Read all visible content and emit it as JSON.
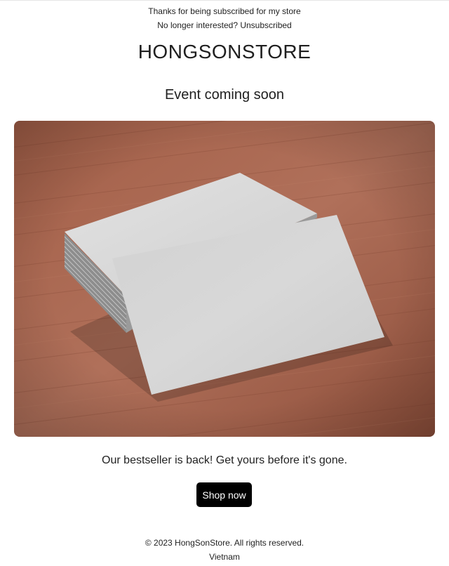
{
  "preheader": {
    "thanks_text": "Thanks for being subscribed for my store",
    "unsubscribe_prefix": "No longer interested? ",
    "unsubscribe_link": "Unsubscribed"
  },
  "brand": {
    "name": "HONGSONSTORE"
  },
  "hero": {
    "headline": "Event coming soon",
    "image": {
      "subject": "stack of blank business cards on wooden table",
      "icon": "business-cards-image"
    }
  },
  "promo": {
    "tagline": "Our bestseller is back! Get yours before it's gone.",
    "cta_label": "Shop now"
  },
  "footer": {
    "copyright": "© 2023 HongSonStore. All rights reserved.",
    "country": "Vietnam"
  },
  "colors": {
    "cta_background": "#000000",
    "cta_text": "#ffffff",
    "wood": "#a8664e",
    "card": "#d6d6d6"
  }
}
